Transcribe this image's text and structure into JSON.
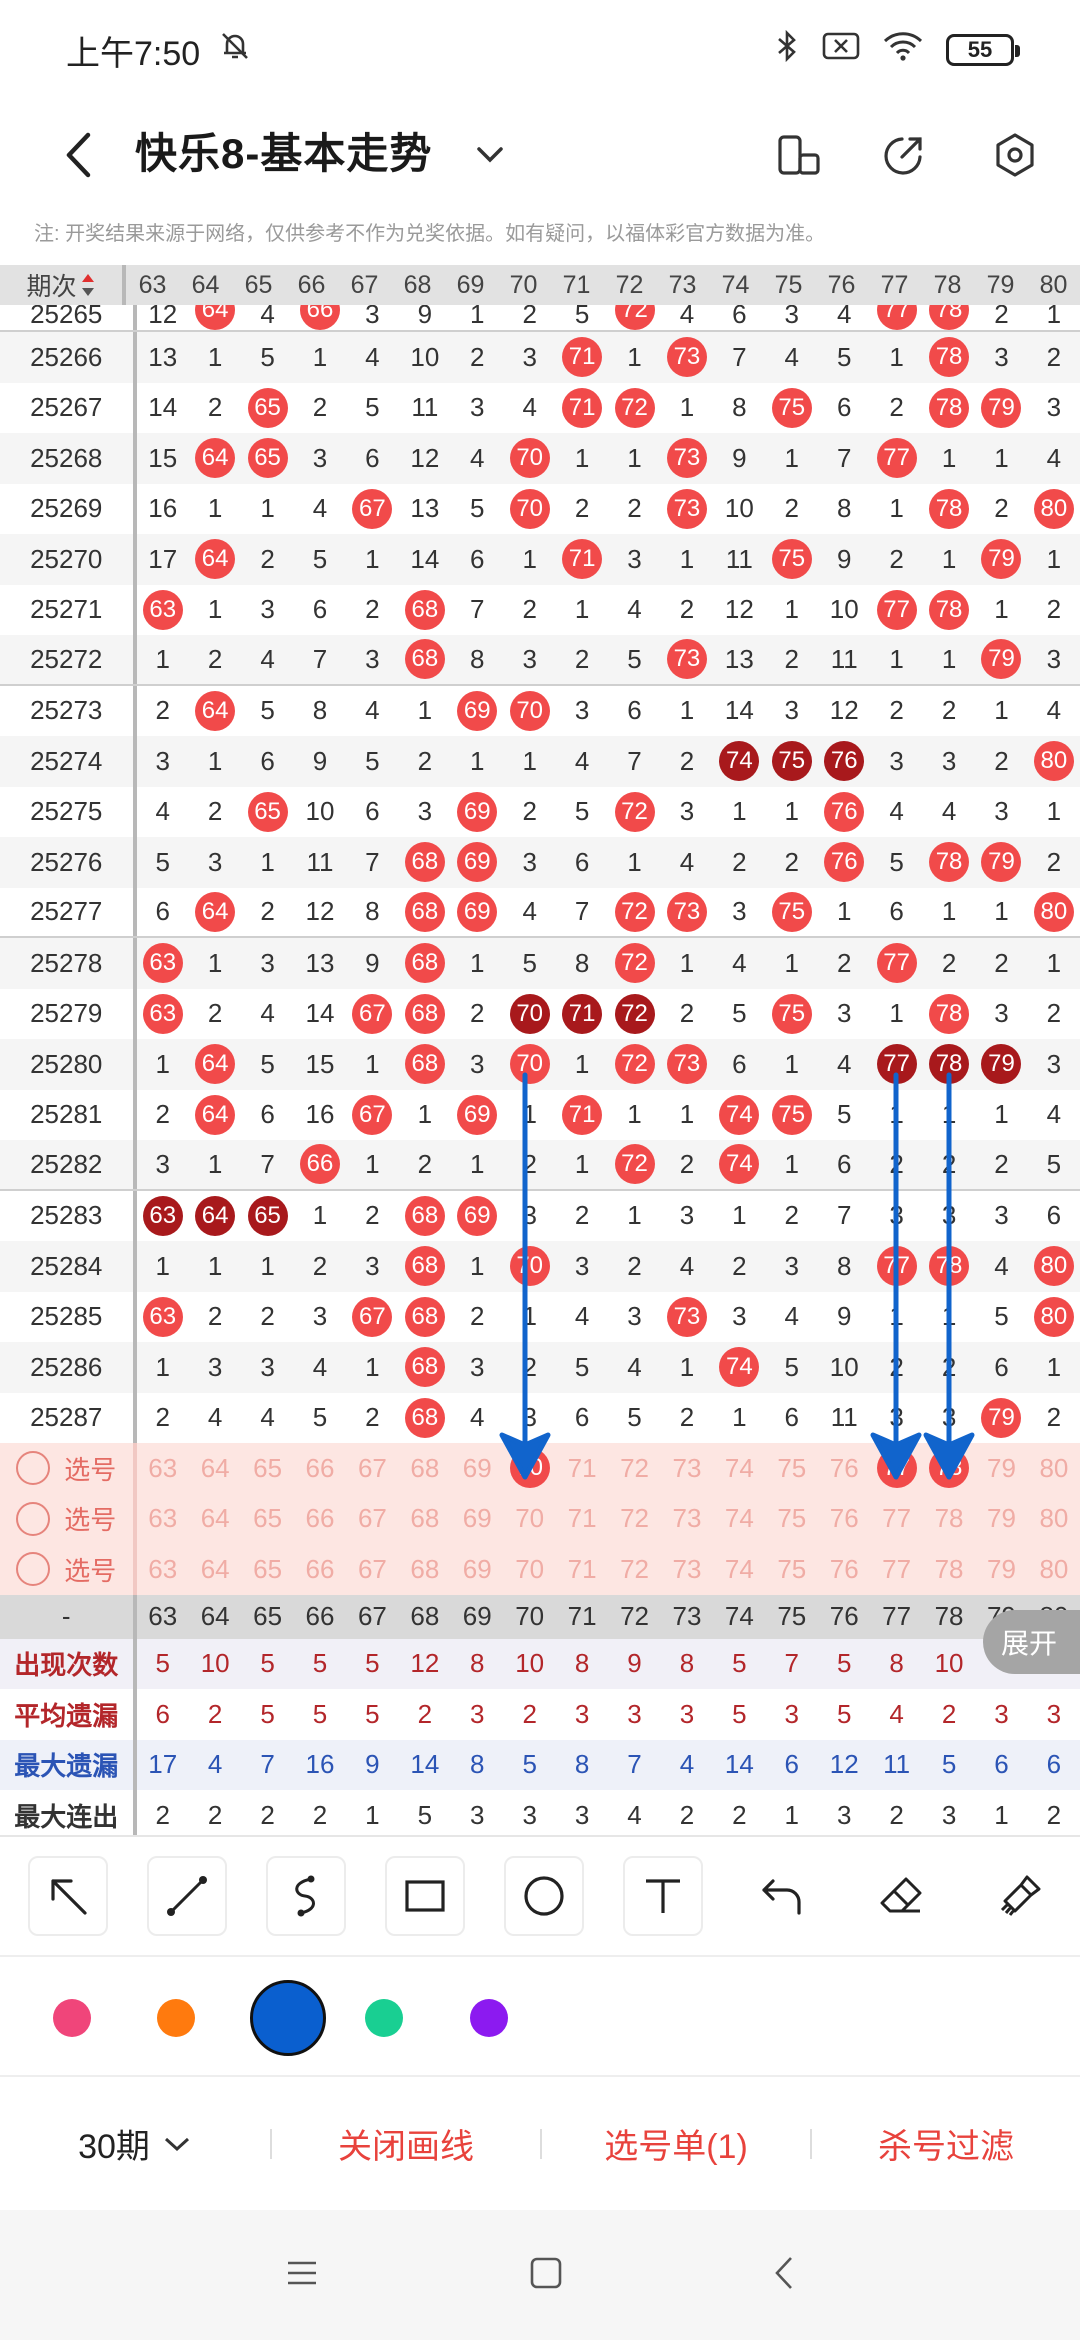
{
  "status": {
    "time": "上午7:50",
    "battery": "55"
  },
  "header": {
    "title": "快乐8-基本走势",
    "note": "注: 开奖结果来源于网络，仅供参考不作为兑奖依据。如有疑问，以福体彩官方数据为准。"
  },
  "grid": {
    "issue_label": "期次",
    "columns": [
      "63",
      "64",
      "65",
      "66",
      "67",
      "68",
      "69",
      "70",
      "71",
      "72",
      "73",
      "74",
      "75",
      "76",
      "77",
      "78",
      "79",
      "80"
    ],
    "rows": [
      {
        "issue": "25265",
        "cells": [
          "12",
          {
            "b": "64"
          },
          "4",
          {
            "b": "66"
          },
          "3",
          "9",
          "1",
          "2",
          "5",
          {
            "b": "72"
          },
          "4",
          "6",
          "3",
          "4",
          {
            "b": "77"
          },
          {
            "b": "78"
          },
          "2",
          "1"
        ]
      },
      {
        "issue": "25266",
        "cells": [
          "13",
          "1",
          "5",
          "1",
          "4",
          "10",
          "2",
          "3",
          {
            "b": "71"
          },
          "1",
          {
            "b": "73"
          },
          "7",
          "4",
          "5",
          "1",
          {
            "b": "78"
          },
          "3",
          "2"
        ]
      },
      {
        "issue": "25267",
        "cells": [
          "14",
          "2",
          {
            "b": "65"
          },
          "2",
          "5",
          "11",
          "3",
          "4",
          {
            "b": "71"
          },
          {
            "b": "72"
          },
          "1",
          "8",
          {
            "b": "75"
          },
          "6",
          "2",
          {
            "b": "78"
          },
          {
            "b": "79"
          },
          "3"
        ]
      },
      {
        "issue": "25268",
        "cells": [
          "15",
          {
            "b": "64"
          },
          {
            "b": "65"
          },
          "3",
          "6",
          "12",
          "4",
          {
            "b": "70"
          },
          "1",
          "1",
          {
            "b": "73"
          },
          "9",
          "1",
          "7",
          {
            "b": "77"
          },
          "1",
          "1",
          "4"
        ]
      },
      {
        "issue": "25269",
        "cells": [
          "16",
          "1",
          "1",
          "4",
          {
            "b": "67"
          },
          "13",
          "5",
          {
            "b": "70"
          },
          "2",
          "2",
          {
            "b": "73"
          },
          "10",
          "2",
          "8",
          "1",
          {
            "b": "78"
          },
          "2",
          {
            "b": "80"
          }
        ]
      },
      {
        "issue": "25270",
        "cells": [
          "17",
          {
            "b": "64"
          },
          "2",
          "5",
          "1",
          "14",
          "6",
          "1",
          {
            "b": "71"
          },
          "3",
          "1",
          "11",
          {
            "b": "75"
          },
          "9",
          "2",
          "1",
          {
            "b": "79"
          },
          "1"
        ]
      },
      {
        "issue": "25271",
        "cells": [
          {
            "b": "63"
          },
          "1",
          "3",
          "6",
          "2",
          {
            "b": "68"
          },
          "7",
          "2",
          "1",
          "4",
          "2",
          "12",
          "1",
          "10",
          {
            "b": "77"
          },
          {
            "b": "78"
          },
          "1",
          "2"
        ]
      },
      {
        "issue": "25272",
        "cells": [
          "1",
          "2",
          "4",
          "7",
          "3",
          {
            "b": "68"
          },
          "8",
          "3",
          "2",
          "5",
          {
            "b": "73"
          },
          "13",
          "2",
          "11",
          "1",
          "1",
          {
            "b": "79"
          },
          "3"
        ]
      },
      {
        "issue": "25273",
        "cells": [
          "2",
          {
            "b": "64"
          },
          "5",
          "8",
          "4",
          "1",
          {
            "b": "69"
          },
          {
            "b": "70"
          },
          "3",
          "6",
          "1",
          "14",
          "3",
          "12",
          "2",
          "2",
          "1",
          "4"
        ]
      },
      {
        "issue": "25274",
        "cells": [
          "3",
          "1",
          "6",
          "9",
          "5",
          "2",
          "1",
          "1",
          "4",
          "7",
          "2",
          {
            "d": "74"
          },
          {
            "d": "75"
          },
          {
            "d": "76"
          },
          "3",
          "3",
          "2",
          {
            "b": "80"
          }
        ]
      },
      {
        "issue": "25275",
        "cells": [
          "4",
          "2",
          {
            "b": "65"
          },
          "10",
          "6",
          "3",
          {
            "b": "69"
          },
          "2",
          "5",
          {
            "b": "72"
          },
          "3",
          "1",
          "1",
          {
            "b": "76"
          },
          "4",
          "4",
          "3",
          "1"
        ]
      },
      {
        "issue": "25276",
        "cells": [
          "5",
          "3",
          "1",
          "11",
          "7",
          {
            "b": "68"
          },
          {
            "b": "69"
          },
          "3",
          "6",
          "1",
          "4",
          "2",
          "2",
          {
            "b": "76"
          },
          "5",
          {
            "b": "78"
          },
          {
            "b": "79"
          },
          "2"
        ]
      },
      {
        "issue": "25277",
        "cells": [
          "6",
          {
            "b": "64"
          },
          "2",
          "12",
          "8",
          {
            "b": "68"
          },
          {
            "b": "69"
          },
          "4",
          "7",
          {
            "b": "72"
          },
          {
            "b": "73"
          },
          "3",
          {
            "b": "75"
          },
          "1",
          "6",
          "1",
          "1",
          {
            "b": "80"
          }
        ]
      },
      {
        "issue": "25278",
        "cells": [
          {
            "b": "63"
          },
          "1",
          "3",
          "13",
          "9",
          {
            "b": "68"
          },
          "1",
          "5",
          "8",
          {
            "b": "72"
          },
          "1",
          "4",
          "1",
          "2",
          {
            "b": "77"
          },
          "2",
          "2",
          "1"
        ]
      },
      {
        "issue": "25279",
        "cells": [
          {
            "b": "63"
          },
          "2",
          "4",
          "14",
          {
            "b": "67"
          },
          {
            "b": "68"
          },
          "2",
          {
            "d": "70"
          },
          {
            "d": "71"
          },
          {
            "d": "72"
          },
          "2",
          "5",
          {
            "b": "75"
          },
          "3",
          "1",
          {
            "b": "78"
          },
          "3",
          "2"
        ]
      },
      {
        "issue": "25280",
        "cells": [
          "1",
          {
            "b": "64"
          },
          "5",
          "15",
          "1",
          {
            "b": "68"
          },
          "3",
          {
            "b": "70"
          },
          "1",
          {
            "b": "72"
          },
          {
            "b": "73"
          },
          "6",
          "1",
          "4",
          {
            "d": "77"
          },
          {
            "d": "78"
          },
          {
            "d": "79"
          },
          "3"
        ]
      },
      {
        "issue": "25281",
        "cells": [
          "2",
          {
            "b": "64"
          },
          "6",
          "16",
          {
            "b": "67"
          },
          "1",
          {
            "b": "69"
          },
          "1",
          {
            "b": "71"
          },
          "1",
          "1",
          {
            "b": "74"
          },
          {
            "b": "75"
          },
          "5",
          "1",
          "1",
          "1",
          "4"
        ]
      },
      {
        "issue": "25282",
        "cells": [
          "3",
          "1",
          "7",
          {
            "b": "66"
          },
          "1",
          "2",
          "1",
          "2",
          "1",
          {
            "b": "72"
          },
          "2",
          {
            "b": "74"
          },
          "1",
          "6",
          "2",
          "2",
          "2",
          "5"
        ]
      },
      {
        "issue": "25283",
        "cells": [
          {
            "d": "63"
          },
          {
            "d": "64"
          },
          {
            "d": "65"
          },
          "1",
          "2",
          {
            "b": "68"
          },
          {
            "b": "69"
          },
          "3",
          "2",
          "1",
          "3",
          "1",
          "2",
          "7",
          "3",
          "3",
          "3",
          "6"
        ]
      },
      {
        "issue": "25284",
        "cells": [
          "1",
          "1",
          "1",
          "2",
          "3",
          {
            "b": "68"
          },
          "1",
          {
            "b": "70"
          },
          "3",
          "2",
          "4",
          "2",
          "3",
          "8",
          {
            "b": "77"
          },
          {
            "b": "78"
          },
          "4",
          {
            "b": "80"
          }
        ]
      },
      {
        "issue": "25285",
        "cells": [
          {
            "b": "63"
          },
          "2",
          "2",
          "3",
          {
            "b": "67"
          },
          {
            "b": "68"
          },
          "2",
          "1",
          "4",
          "3",
          {
            "b": "73"
          },
          "3",
          "4",
          "9",
          "1",
          "1",
          "5",
          {
            "b": "80"
          }
        ]
      },
      {
        "issue": "25286",
        "cells": [
          "1",
          "3",
          "3",
          "4",
          "1",
          {
            "b": "68"
          },
          "3",
          "2",
          "5",
          "4",
          "1",
          {
            "b": "74"
          },
          "5",
          "10",
          "2",
          "2",
          "6",
          "1"
        ]
      },
      {
        "issue": "25287",
        "cells": [
          "2",
          "4",
          "4",
          "5",
          "2",
          {
            "b": "68"
          },
          "4",
          "3",
          "6",
          "5",
          "2",
          "1",
          "6",
          "11",
          "3",
          "3",
          {
            "b": "79"
          },
          "2"
        ]
      }
    ],
    "pick_label": "选号",
    "pick_rows": [
      [
        "63",
        "64",
        "65",
        "66",
        "67",
        "68",
        "69",
        {
          "b": "70"
        },
        "71",
        "72",
        "73",
        "74",
        "75",
        "76",
        {
          "b": "77"
        },
        {
          "b": "78"
        },
        "79",
        "80"
      ],
      [
        "63",
        "64",
        "65",
        "66",
        "67",
        "68",
        "69",
        "70",
        "71",
        "72",
        "73",
        "74",
        "75",
        "76",
        "77",
        "78",
        "79",
        "80"
      ],
      [
        "63",
        "64",
        "65",
        "66",
        "67",
        "68",
        "69",
        "70",
        "71",
        "72",
        "73",
        "74",
        "75",
        "76",
        "77",
        "78",
        "79",
        "80"
      ]
    ],
    "stats_header_label": "-",
    "stats": [
      {
        "label": "出现次数",
        "values": [
          "5",
          "10",
          "5",
          "5",
          "5",
          "12",
          "8",
          "10",
          "8",
          "9",
          "8",
          "5",
          "7",
          "5",
          "8",
          "10",
          "",
          ""
        ]
      },
      {
        "label": "平均遗漏",
        "values": [
          "6",
          "2",
          "5",
          "5",
          "5",
          "2",
          "3",
          "2",
          "3",
          "3",
          "3",
          "5",
          "3",
          "5",
          "4",
          "2",
          "3",
          "3"
        ]
      },
      {
        "label": "最大遗漏",
        "values": [
          "17",
          "4",
          "7",
          "16",
          "9",
          "14",
          "8",
          "5",
          "8",
          "7",
          "4",
          "14",
          "6",
          "12",
          "11",
          "5",
          "6",
          "6"
        ]
      },
      {
        "label": "最大连出",
        "values": [
          "2",
          "2",
          "2",
          "2",
          "1",
          "5",
          "3",
          "3",
          "3",
          "4",
          "2",
          "2",
          "1",
          "3",
          "2",
          "3",
          "1",
          "2"
        ]
      }
    ],
    "expand_label": "展开"
  },
  "tools": [
    "arrow-tool",
    "line-tool",
    "curve-tool",
    "rectangle-tool",
    "circle-tool",
    "text-tool",
    "undo-tool",
    "eraser-tool",
    "clear-tool"
  ],
  "colors": [
    "#f0457a",
    "#ff7a0e",
    "#0a5fcf",
    "#19cf92",
    "#8c1af0"
  ],
  "bottom": {
    "periods": "30期",
    "close_lines": "关闭画线",
    "pick_list": "选号单(1)",
    "kill_filter": "杀号过滤"
  }
}
